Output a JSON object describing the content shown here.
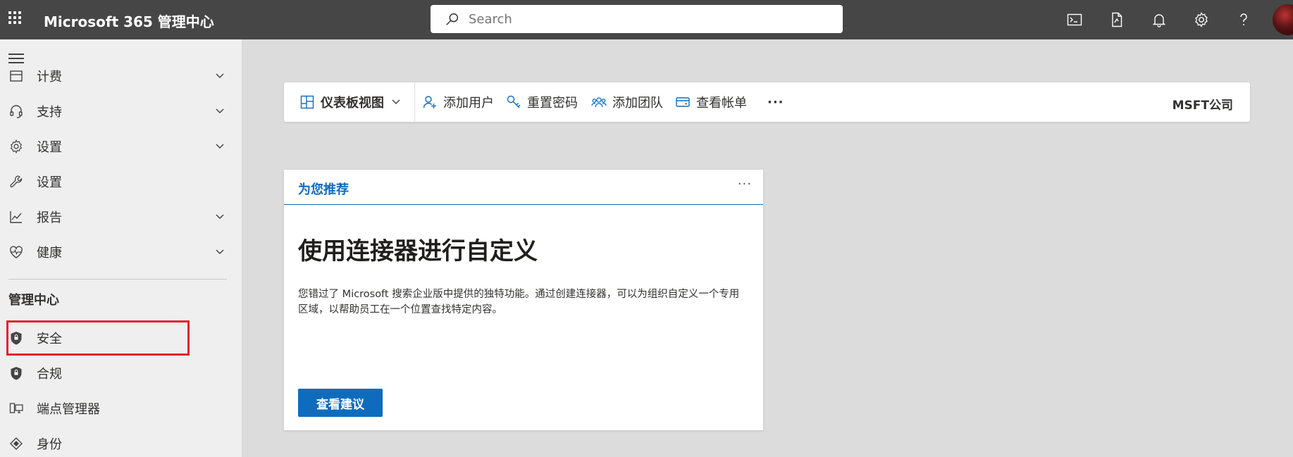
{
  "header": {
    "app_title": "Microsoft 365 管理中心",
    "search_placeholder": "Search",
    "icons": [
      "waffle-icon",
      "terminal-icon",
      "document-icon",
      "bell-icon",
      "gear-icon",
      "help-icon"
    ]
  },
  "sidebar": {
    "items": [
      {
        "label": "计费",
        "icon": "billing-icon",
        "expandable": true
      },
      {
        "label": "支持",
        "icon": "headset-icon",
        "expandable": true
      },
      {
        "label": "设置",
        "icon": "gear-icon",
        "expandable": true
      },
      {
        "label": "设置",
        "icon": "wrench-icon",
        "expandable": false
      },
      {
        "label": "报告",
        "icon": "chart-icon",
        "expandable": true
      },
      {
        "label": "健康",
        "icon": "heart-icon",
        "expandable": true
      }
    ],
    "section_title": "管理中心",
    "admin_items": [
      {
        "label": "安全",
        "icon": "shield-icon"
      },
      {
        "label": "合规",
        "icon": "shield-icon"
      },
      {
        "label": "端点管理器",
        "icon": "devices-icon"
      },
      {
        "label": "身份",
        "icon": "identity-icon"
      }
    ]
  },
  "command_bar": {
    "dashboard_view": "仪表板视图",
    "add_user": "添加用户",
    "reset_password": "重置密码",
    "add_team": "添加团队",
    "view_bill": "查看帐单",
    "more": "···",
    "company": "MSFT公司"
  },
  "card": {
    "header_title": "为您推荐",
    "more": "···",
    "heading": "使用连接器进行自定义",
    "body": "您错过了 Microsoft 搜索企业版中提供的独特功能。通过创建连接器，可以为组织自定义一个专用区域，以帮助员工在一个位置查找特定内容。",
    "button": "查看建议"
  },
  "colors": {
    "topbar": "#464646",
    "accent": "#0f6cbd",
    "highlight": "#e3242b"
  }
}
